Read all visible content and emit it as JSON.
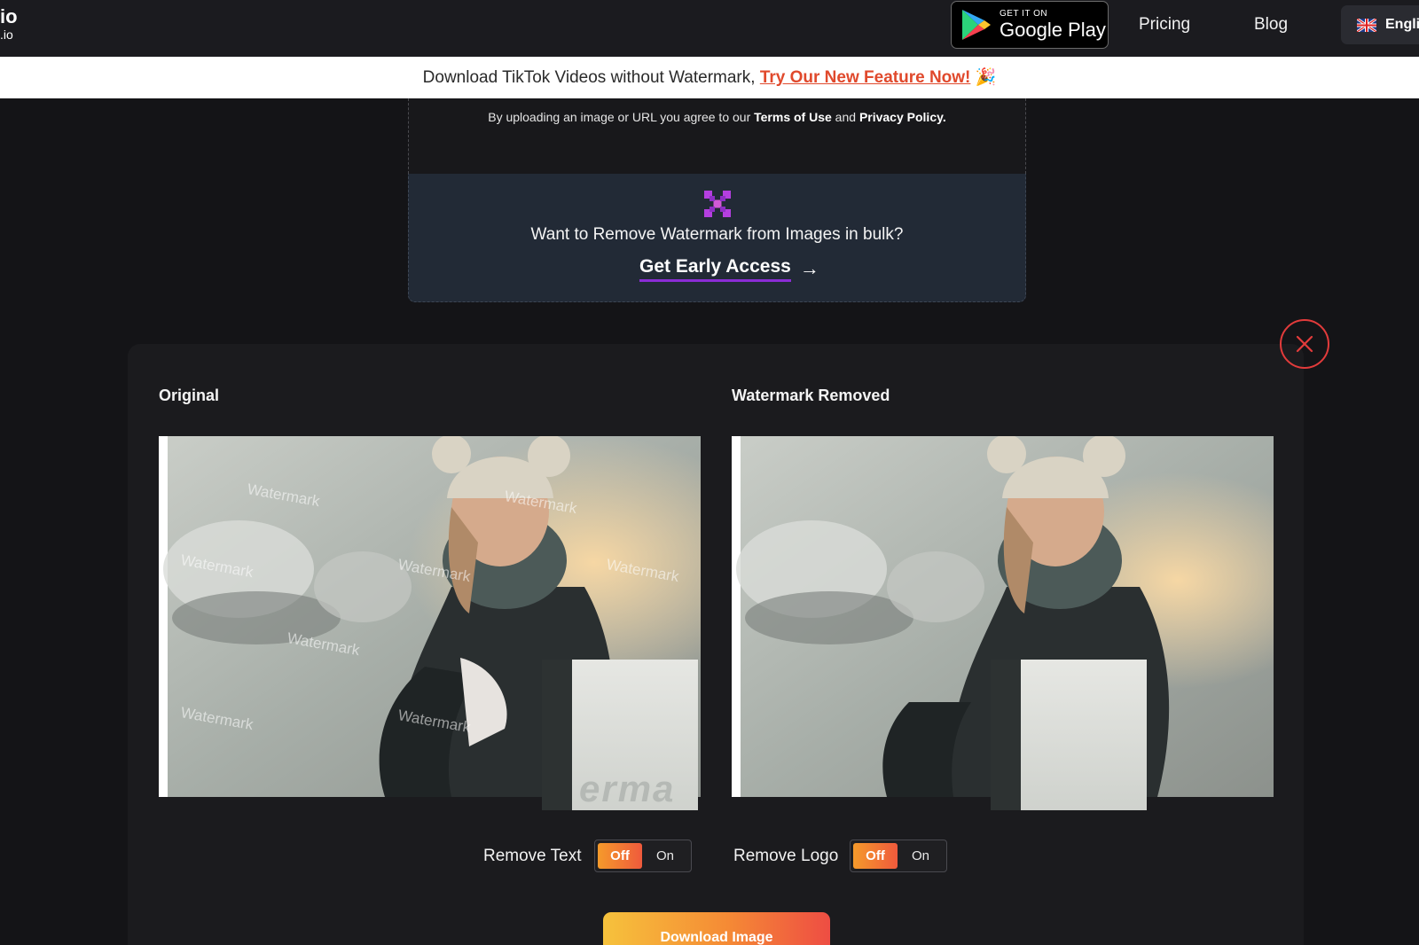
{
  "nav": {
    "logo_line1": "io",
    "logo_line2": ".io",
    "google_play_small": "GET IT ON",
    "google_play_big": "Google Play",
    "pricing": "Pricing",
    "blog": "Blog",
    "language": "English"
  },
  "announcement": {
    "text": "Download TikTok Videos without Watermark, ",
    "link": "Try Our New Feature Now!",
    "emoji": "🎉"
  },
  "upload": {
    "terms_prefix": "By uploading an image or URL you agree to our ",
    "terms_link": "Terms of Use",
    "terms_and": " and ",
    "privacy_link": "Privacy Policy."
  },
  "bulk": {
    "question": "Want to Remove Watermark from Images in bulk?",
    "cta": "Get Early Access",
    "cta_arrow": "→"
  },
  "result": {
    "original_heading": "Original",
    "removed_heading": "Watermark Removed",
    "watermark_word": "Watermark",
    "sticker_text": "erma",
    "remove_text_label": "Remove Text",
    "remove_logo_label": "Remove Logo",
    "toggle_off": "Off",
    "toggle_on": "On",
    "download": "Download Image"
  },
  "colors": {
    "accent_orange": "#f58a35",
    "link_red": "#e0492c",
    "close_red": "#e23b3b",
    "underline_purple": "#8b2cd6"
  }
}
